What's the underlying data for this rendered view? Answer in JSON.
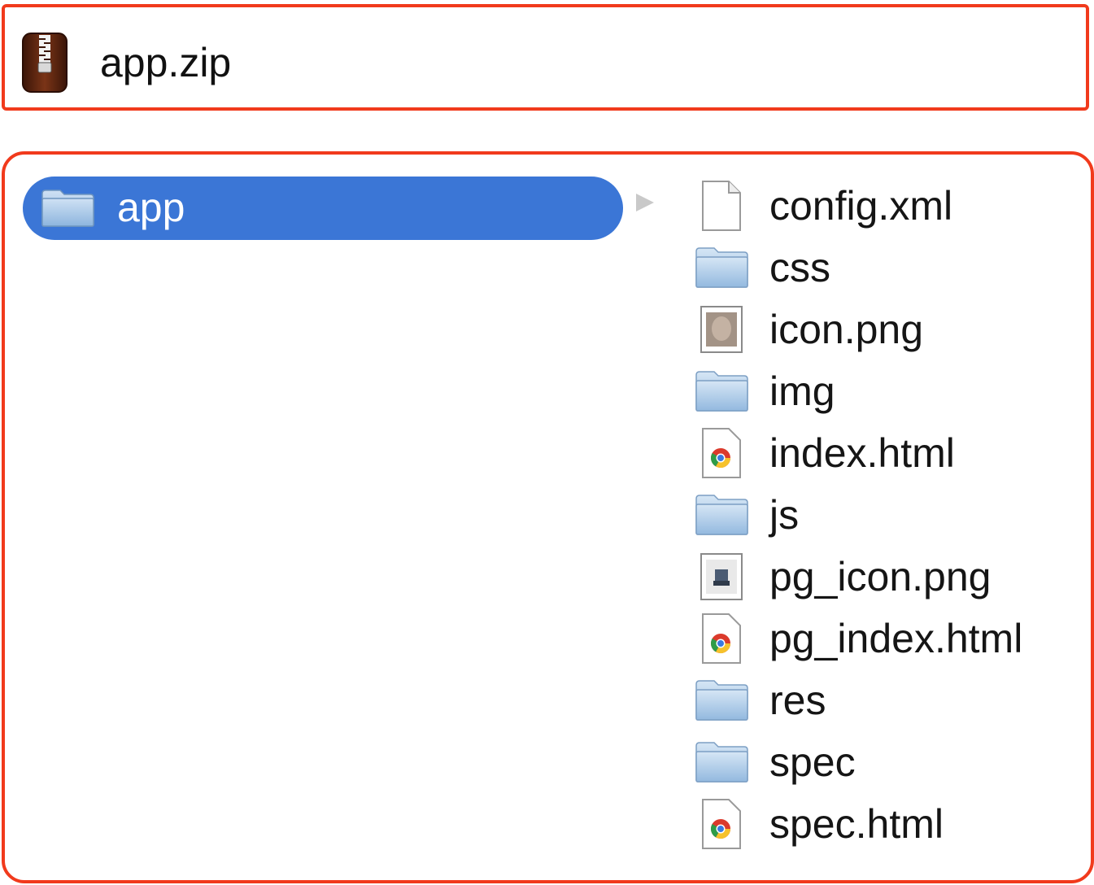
{
  "archive": {
    "name": "app.zip",
    "icon": "zip-archive-icon"
  },
  "browser": {
    "selected_folder": {
      "label": "app",
      "icon": "folder-icon"
    },
    "files": [
      {
        "label": "config.xml",
        "icon": "document-icon"
      },
      {
        "label": "css",
        "icon": "folder-icon"
      },
      {
        "label": "icon.png",
        "icon": "image-thumbnail-icon"
      },
      {
        "label": "img",
        "icon": "folder-icon"
      },
      {
        "label": "index.html",
        "icon": "chrome-html-icon"
      },
      {
        "label": "js",
        "icon": "folder-icon"
      },
      {
        "label": "pg_icon.png",
        "icon": "image-thumbnail-icon"
      },
      {
        "label": "pg_index.html",
        "icon": "chrome-html-icon"
      },
      {
        "label": "res",
        "icon": "folder-icon"
      },
      {
        "label": "spec",
        "icon": "folder-icon"
      },
      {
        "label": "spec.html",
        "icon": "chrome-html-icon"
      }
    ]
  },
  "colors": {
    "highlight_border": "#f13a1c",
    "selection_bg": "#3b76d6",
    "folder_blue": "#9ec3e6"
  }
}
